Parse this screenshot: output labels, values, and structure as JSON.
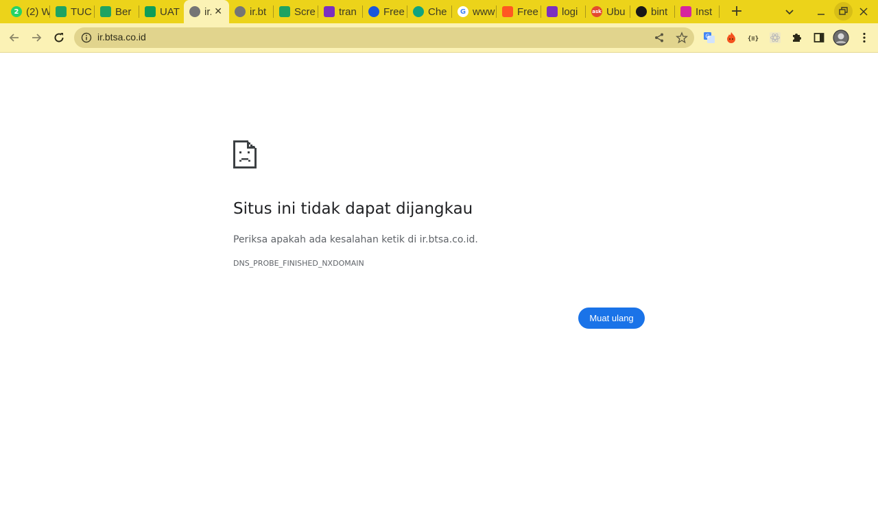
{
  "tabs": [
    {
      "title": "(2) W",
      "icon": "whatsapp-icon",
      "color": "#25d366",
      "glyph": "2"
    },
    {
      "title": "TUC",
      "icon": "google-drive-icon",
      "color": "#1ea362",
      "glyph": ""
    },
    {
      "title": "Ber",
      "icon": "google-drive-icon",
      "color": "#1ea362",
      "glyph": ""
    },
    {
      "title": "UAT",
      "icon": "google-sheets-icon",
      "color": "#0f9d58",
      "glyph": ""
    },
    {
      "title": "ir.bt",
      "icon": "globe-icon",
      "color": "#757575",
      "glyph": "",
      "active": true
    },
    {
      "title": "ir.bt",
      "icon": "globe-icon",
      "color": "#757575",
      "glyph": ""
    },
    {
      "title": "Scre",
      "icon": "google-drive-icon",
      "color": "#1ea362",
      "glyph": ""
    },
    {
      "title": "tran",
      "icon": "app-icon",
      "color": "#7b2fbe",
      "glyph": ""
    },
    {
      "title": "Free",
      "icon": "play-icon",
      "color": "#1a56db",
      "glyph": ""
    },
    {
      "title": "Che",
      "icon": "openai-icon",
      "color": "#10a37f",
      "glyph": ""
    },
    {
      "title": "www",
      "icon": "google-icon",
      "color": "#4285f4",
      "glyph": "G"
    },
    {
      "title": "Free",
      "icon": "freepik-icon",
      "color": "#ff5722",
      "glyph": ""
    },
    {
      "title": "logi",
      "icon": "app-icon",
      "color": "#7b2fbe",
      "glyph": ""
    },
    {
      "title": "Ubu",
      "icon": "ask-icon",
      "color": "#e4492f",
      "glyph": "ask"
    },
    {
      "title": "bint",
      "icon": "github-icon",
      "color": "#181717",
      "glyph": ""
    },
    {
      "title": "Inst",
      "icon": "instagram-icon",
      "color": "#d6249f",
      "glyph": ""
    }
  ],
  "active_tab_close": "✕",
  "new_tab_label": "+",
  "omnibox": {
    "url": "ir.btsa.co.id"
  },
  "error_page": {
    "title": "Situs ini tidak dapat dijangkau",
    "description": "Periksa apakah ada kesalahan ketik di ir.btsa.co.id.",
    "error_code": "DNS_PROBE_FINISHED_NXDOMAIN",
    "reload_button": "Muat ulang"
  },
  "colors": {
    "tabstrip": "#ecd31a",
    "toolbar": "#fbf2b5",
    "omnibox": "#e1d48d",
    "button": "#1a73e8"
  }
}
